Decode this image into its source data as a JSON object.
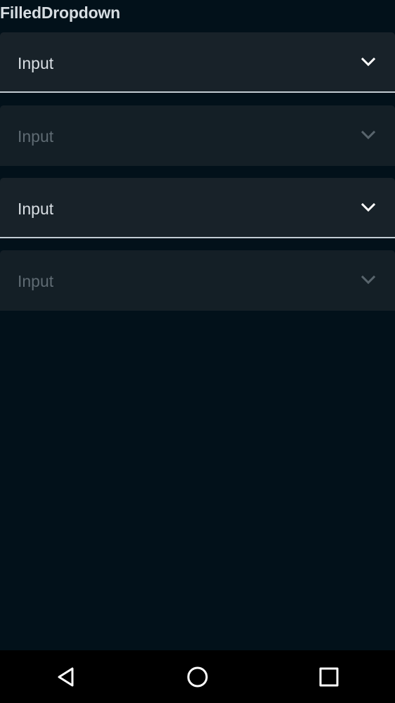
{
  "page": {
    "title": "FilledDropdown"
  },
  "dropdowns": [
    {
      "value": "Input",
      "state": "enabled",
      "icon": "chevron-down-icon"
    },
    {
      "value": "Input",
      "state": "disabled",
      "icon": "chevron-down-icon"
    },
    {
      "value": "Input",
      "state": "enabled",
      "icon": "chevron-down-icon"
    },
    {
      "value": "Input",
      "state": "disabled",
      "icon": "chevron-down-icon"
    }
  ],
  "navigation_bar": {
    "buttons": [
      {
        "icon": "back-triangle-icon"
      },
      {
        "icon": "home-circle-icon"
      },
      {
        "icon": "recents-square-icon"
      }
    ]
  },
  "colors": {
    "background": "#02111a",
    "field_background": "#182229",
    "field_disabled_background": "#141f26",
    "text": "#d9dfe4",
    "disabled_text": "#5f6b73",
    "underline": "#c3ccd3",
    "nav_bar": "#000000"
  }
}
